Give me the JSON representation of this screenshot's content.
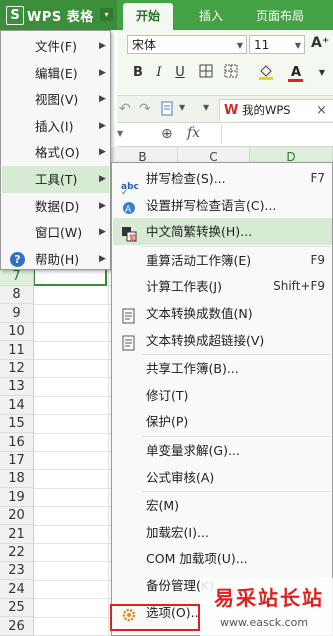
{
  "app": {
    "logo": "S",
    "title": "WPS 表格",
    "dropdown": "▾"
  },
  "ribbon_tabs": [
    "开始",
    "插入",
    "页面布局"
  ],
  "ribbon": {
    "font_name": "宋体",
    "font_size": "11",
    "grow_font": "A⁺",
    "bold": "B",
    "italic": "I",
    "underline": "U"
  },
  "quick_access": {
    "doc_tab": "我的WPS",
    "close": "×"
  },
  "formula_bar": {
    "fx": "fx"
  },
  "columns": [
    "B",
    "C",
    "D"
  ],
  "rows": [
    "7",
    "8",
    "9",
    "10",
    "11",
    "12",
    "13",
    "14",
    "15",
    "16",
    "17",
    "18",
    "19",
    "20",
    "21",
    "22",
    "23",
    "24",
    "25",
    "26"
  ],
  "menu": [
    {
      "label": "文件(F)"
    },
    {
      "label": "编辑(E)"
    },
    {
      "label": "视图(V)"
    },
    {
      "label": "插入(I)"
    },
    {
      "label": "格式(O)"
    },
    {
      "label": "工具(T)"
    },
    {
      "label": "数据(D)"
    },
    {
      "label": "窗口(W)"
    },
    {
      "label": "帮助(H)"
    }
  ],
  "tools_submenu": [
    {
      "label": "拼写检查(S)...",
      "key": "F7"
    },
    {
      "label": "设置拼写检查语言(C)...",
      "key": ""
    },
    {
      "label": "中文简繁转换(H)...",
      "key": ""
    },
    {
      "label": "重算活动工作簿(E)",
      "key": "F9"
    },
    {
      "label": "计算工作表(J)",
      "key": "Shift+F9"
    },
    {
      "label": "文本转换成数值(N)",
      "key": ""
    },
    {
      "label": "文本转换成超链接(V)",
      "key": ""
    },
    {
      "label": "共享工作簿(B)...",
      "key": ""
    },
    {
      "label": "修订(T)",
      "key": ""
    },
    {
      "label": "保护(P)",
      "key": ""
    },
    {
      "label": "单变量求解(G)...",
      "key": ""
    },
    {
      "label": "公式审核(A)",
      "key": ""
    },
    {
      "label": "宏(M)",
      "key": ""
    },
    {
      "label": "加载宏(I)...",
      "key": ""
    },
    {
      "label": "COM 加载项(U)...",
      "key": ""
    },
    {
      "label": "备份管理(K)",
      "key": ""
    },
    {
      "label": "选项(O)...",
      "key": ""
    }
  ],
  "watermark": {
    "text": "易采站长站",
    "url": "www.easck.com"
  },
  "colors": {
    "brand": "#43a243",
    "highlight": "#d7ead3",
    "annotation": "#e02020"
  }
}
